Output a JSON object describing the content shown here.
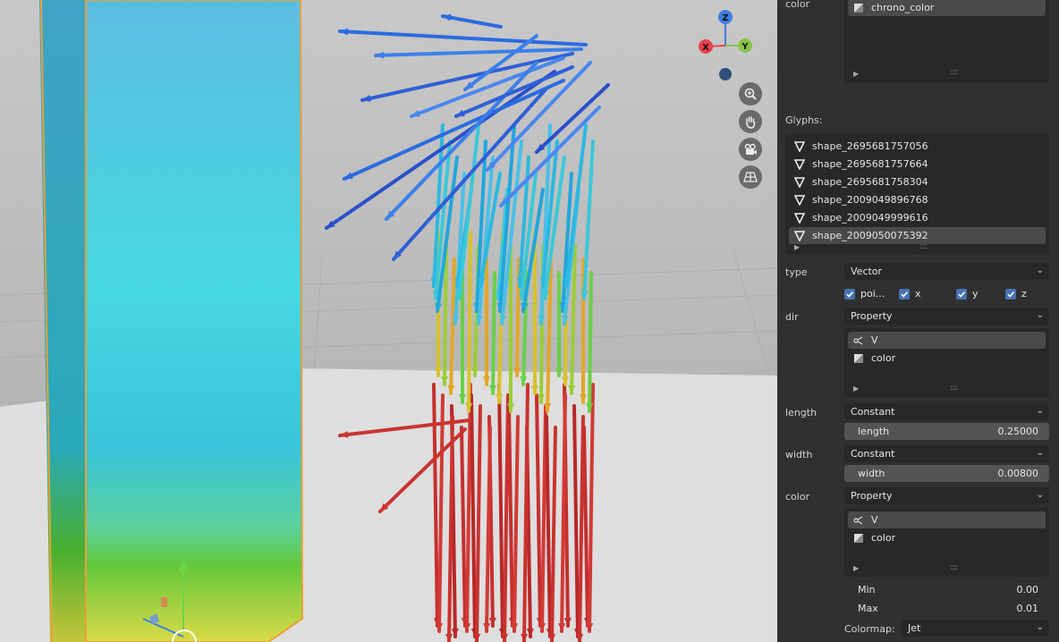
{
  "viewport": {
    "axis_labels": {
      "x": "X",
      "y": "Y",
      "z": "Z"
    },
    "colors": {
      "x_axis": "#e8414c",
      "y_axis": "#8bc34a",
      "z_axis": "#3f7de0",
      "cube": "#4cc7d6",
      "ground": "#dcdcdc"
    },
    "nav_icons": [
      "zoom-icon",
      "hand-pan-icon",
      "camera-icon",
      "perspective-grid-icon"
    ]
  },
  "panel": {
    "top_color_label": "color",
    "top_color_item": "chrono_color",
    "glyphs_label": "Glyphs:",
    "glyphs": [
      {
        "name": "shape_2695681757056",
        "selected": false
      },
      {
        "name": "shape_2695681757664",
        "selected": false
      },
      {
        "name": "shape_2695681758304",
        "selected": false
      },
      {
        "name": "shape_2009049896768",
        "selected": false
      },
      {
        "name": "shape_2009049999616",
        "selected": false
      },
      {
        "name": "shape_2009050075392",
        "selected": true
      }
    ],
    "type": {
      "label": "type",
      "value": "Vector"
    },
    "checkboxes": [
      {
        "label": "poi...",
        "checked": true
      },
      {
        "label": "x",
        "checked": true
      },
      {
        "label": "y",
        "checked": true
      },
      {
        "label": "z",
        "checked": true
      }
    ],
    "dir": {
      "label": "dir",
      "value": "Property",
      "items": [
        "V",
        "color"
      ]
    },
    "length": {
      "label": "length",
      "value": "Constant",
      "field_label": "length",
      "field_value": "0.25000"
    },
    "width": {
      "label": "width",
      "value": "Constant",
      "field_label": "width",
      "field_value": "0.00800"
    },
    "color": {
      "label": "color",
      "value": "Property",
      "items": [
        "V",
        "color"
      ]
    },
    "min": {
      "label": "Min",
      "value": "0.00"
    },
    "max": {
      "label": "Max",
      "value": "0.01"
    },
    "colormap": {
      "label": "Colormap:",
      "value": "Jet"
    },
    "grip": "::::"
  }
}
